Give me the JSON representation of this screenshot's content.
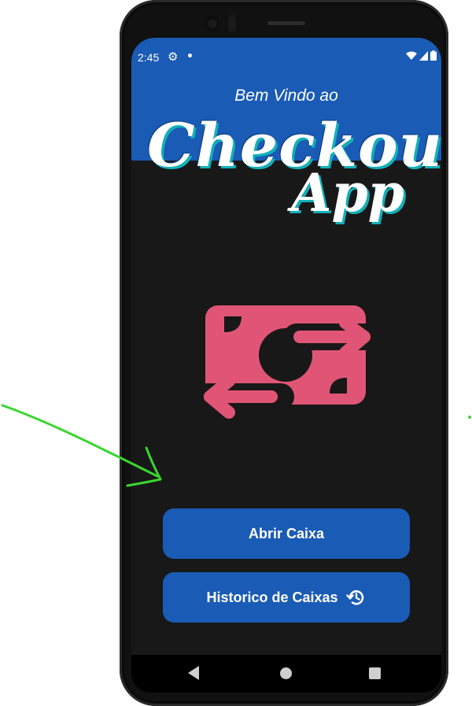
{
  "status_bar": {
    "time": "2:45",
    "icons": [
      "gear-icon",
      "notification-dot-icon",
      "wifi-icon",
      "signal-icon",
      "battery-icon"
    ]
  },
  "header": {
    "welcome": "Bem Vindo ao",
    "title_line1": "Checkout",
    "title_line2": "App"
  },
  "hero_icon": "money-transfer-icon",
  "buttons": {
    "open_register": "Abrir Caixa",
    "register_history": "Historico de Caixas",
    "register_history_icon": "history-icon"
  },
  "colors": {
    "primary": "#1a5bb5",
    "background": "#181818",
    "icon_pink": "#e05575",
    "title_shadow": "#13b0b8",
    "annotation": "#3ad62f"
  }
}
